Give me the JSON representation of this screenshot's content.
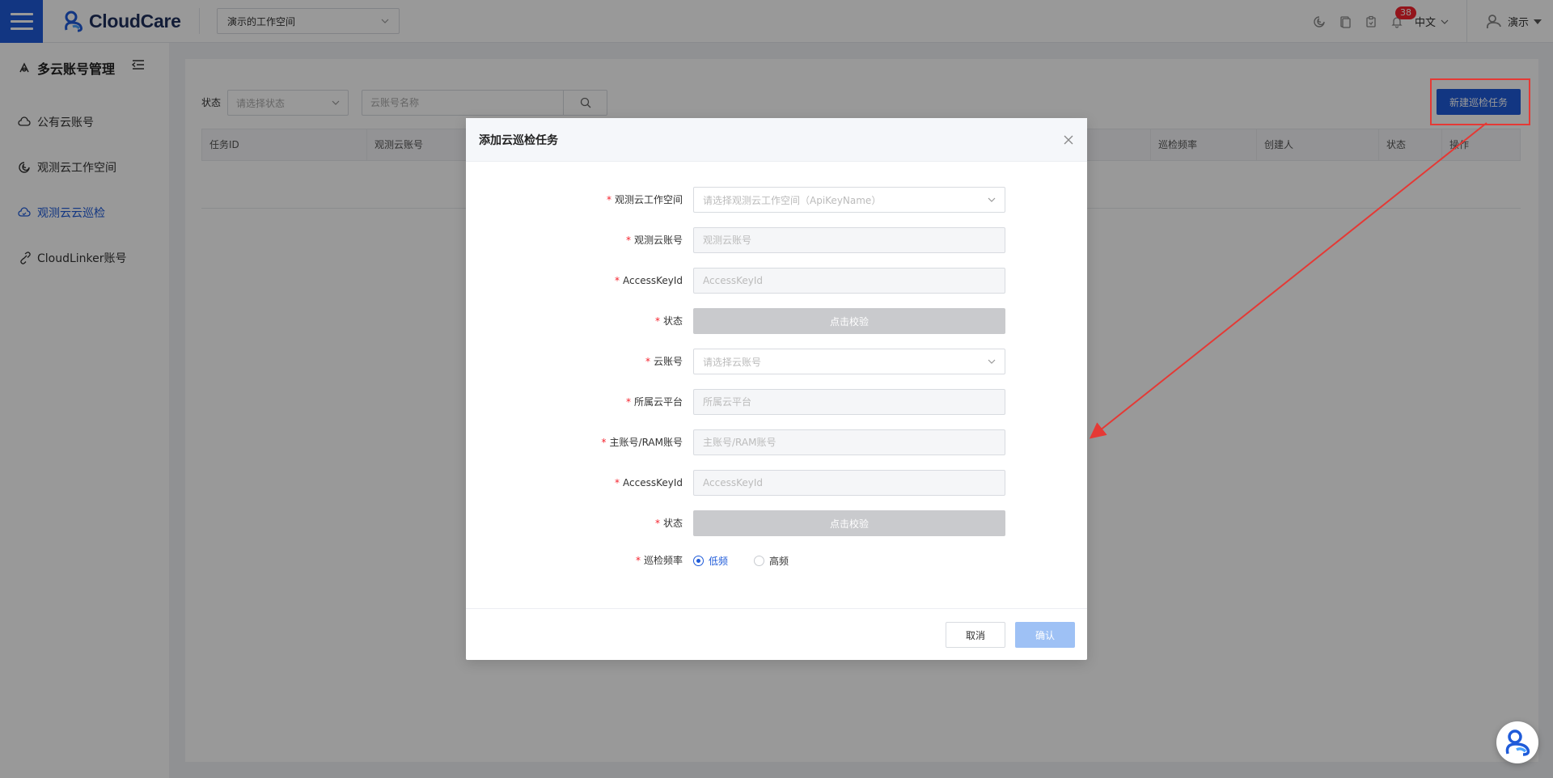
{
  "app": {
    "logo_text": "CloudCare",
    "workspace": "演示的工作空间"
  },
  "header": {
    "notification_count": "38",
    "language": "中文",
    "user_name": "演示"
  },
  "sidebar": {
    "title": "多云账号管理",
    "items": [
      {
        "label": "公有云账号"
      },
      {
        "label": "观测云工作空间"
      },
      {
        "label": "观测云云巡检"
      },
      {
        "label": "CloudLinker账号"
      }
    ],
    "active_index": 2
  },
  "main": {
    "filter_label": "状态",
    "filter_placeholder": "请选择状态",
    "search_placeholder": "云账号名称",
    "new_task_label": "新建巡检任务",
    "columns": [
      "任务ID",
      "观测云账号",
      "",
      "巡检频率",
      "创建人",
      "状态",
      "操作"
    ]
  },
  "modal": {
    "title": "添加云巡检任务",
    "fields": {
      "workspace": {
        "label": "观测云工作空间",
        "placeholder": "请选择观测云工作空间（ApiKeyName）"
      },
      "account": {
        "label": "观测云账号",
        "placeholder": "观测云账号"
      },
      "access_key_1": {
        "label": "AccessKeyId",
        "placeholder": "AccessKeyId"
      },
      "status_1": {
        "label": "状态",
        "button": "点击校验"
      },
      "cloud_account": {
        "label": "云账号",
        "placeholder": "请选择云账号"
      },
      "platform": {
        "label": "所属云平台",
        "placeholder": "所属云平台"
      },
      "main_account": {
        "label": "主账号/RAM账号",
        "placeholder": "主账号/RAM账号"
      },
      "access_key_2": {
        "label": "AccessKeyId",
        "placeholder": "AccessKeyId"
      },
      "status_2": {
        "label": "状态",
        "button": "点击校验"
      },
      "frequency": {
        "label": "巡检频率",
        "options": [
          "低频",
          "高频"
        ],
        "selected": "低频"
      }
    },
    "cancel_label": "取消",
    "confirm_label": "确认"
  },
  "colors": {
    "primary": "#1f5bd9",
    "danger": "#e53935",
    "required": "#f5222d"
  }
}
